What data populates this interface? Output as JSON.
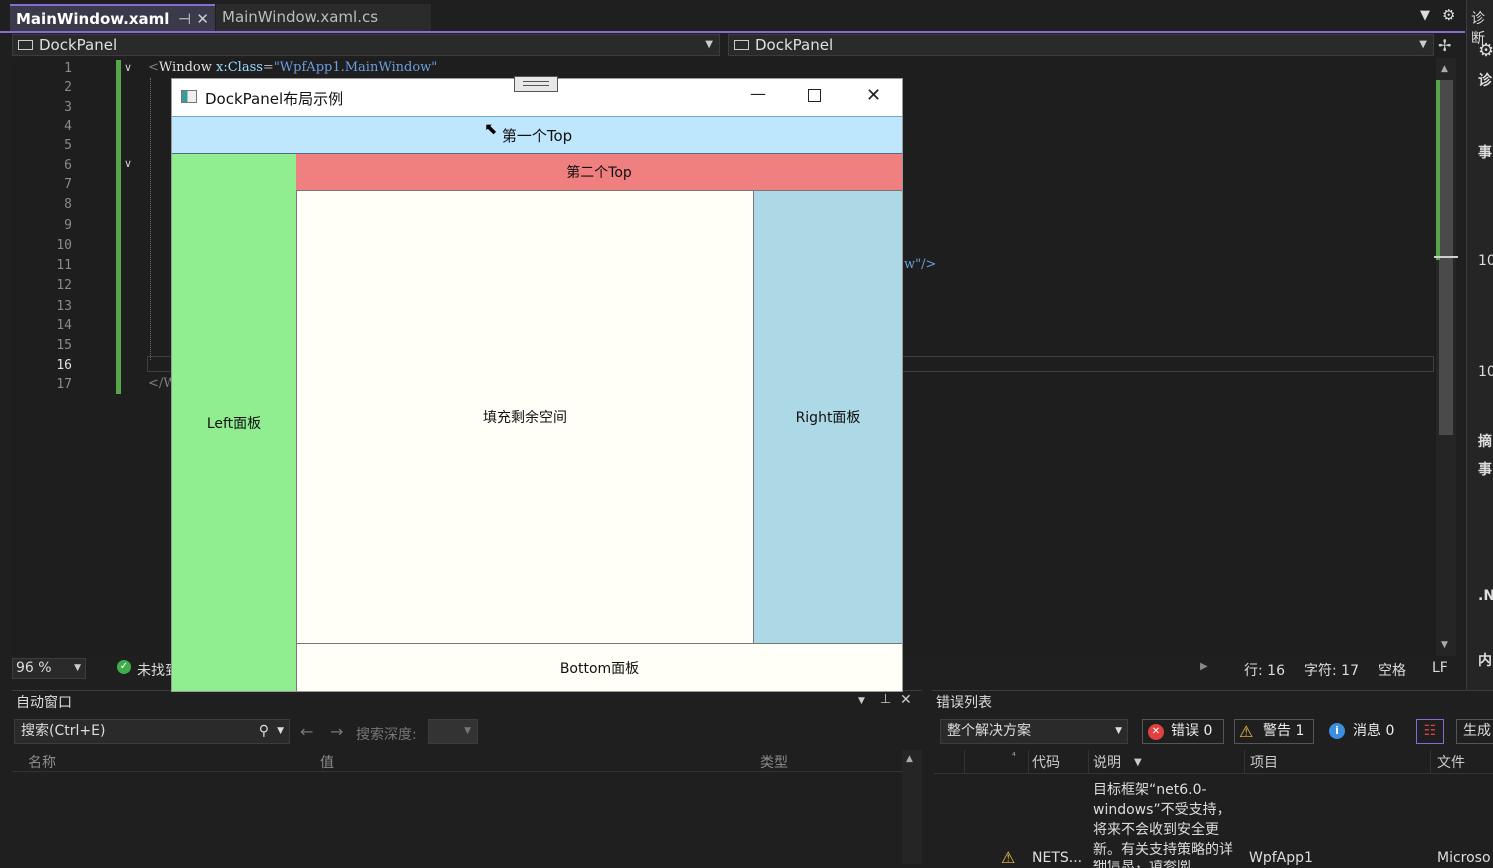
{
  "tabs": [
    {
      "label": "MainWindow.xaml",
      "active": true
    },
    {
      "label": "MainWindow.xaml.cs",
      "active": false
    }
  ],
  "nav": {
    "left": "DockPanel",
    "right": "DockPanel"
  },
  "editor": {
    "line_numbers": [
      "1",
      "2",
      "3",
      "4",
      "5",
      "6",
      "7",
      "8",
      "9",
      "10",
      "11",
      "12",
      "13",
      "14",
      "15",
      "16",
      "17"
    ],
    "current_line": "16",
    "line1_code": {
      "lt": "<",
      "tag": "Window",
      "attr": "x:Class",
      "eq": "=",
      "value": "\"WpfApp1.MainWindow\""
    },
    "line11_tail": "w\"/>",
    "line17_code": "</W"
  },
  "status": {
    "zoom": "96 %",
    "issues": "未找到",
    "line": "行: 16",
    "char": "字符: 17",
    "spaces": "空格",
    "eol": "LF"
  },
  "right_strip": {
    "title": "诊断",
    "items": [
      "诊",
      "事",
      "10",
      "10",
      "摘",
      "事",
      ".N",
      "内"
    ]
  },
  "wpf_window": {
    "title": "DockPanel布局示例",
    "top1": "第一个Top",
    "top2": "第二个Top",
    "left": "Left面板",
    "right": "Right面板",
    "fill": "填充剩余空间",
    "bottom": "Bottom面板",
    "colors": {
      "top1": "#bee6fd",
      "top2": "#f08080",
      "left": "#90ee90",
      "right": "#add8e6",
      "fill": "#fffff8"
    }
  },
  "auto_window": {
    "title": "自动窗口",
    "search_placeholder": "搜索(Ctrl+E)",
    "depth_label": "搜索深度:",
    "columns": [
      "名称",
      "值",
      "类型"
    ]
  },
  "error_list": {
    "title": "错误列表",
    "scope": "整个解决方案",
    "errors": "错误 0",
    "warnings": "警告 1",
    "messages": "消息 0",
    "build": "生成",
    "columns": [
      "代码",
      "说明",
      "项目",
      "文件"
    ],
    "row": {
      "code": "NETS...",
      "description_lines": [
        "目标框架“net6.0-",
        "windows”不受支持，",
        "将来不会收到安全更",
        "新。有关支持策略的详",
        "细信息，请参阅"
      ],
      "project": "WpfApp1",
      "file": "Microso"
    }
  },
  "accent_colors": {
    "purple": "#8a6bd6",
    "green": "#57a64a",
    "error": "#e04040",
    "warning": "#f0c040",
    "info": "#3c8fe0"
  }
}
